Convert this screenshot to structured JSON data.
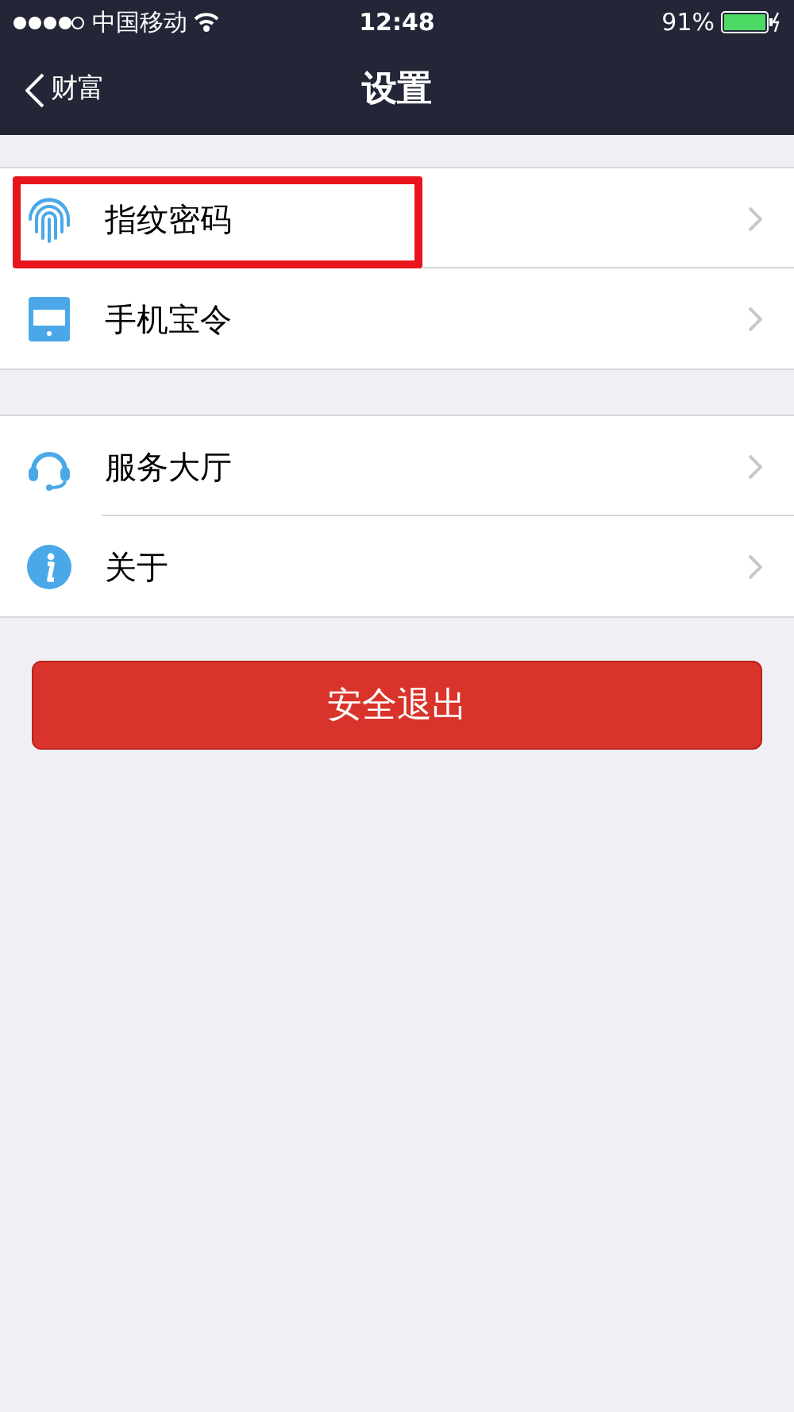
{
  "status_bar": {
    "carrier": "中国移动",
    "time": "12:48",
    "battery": "91%"
  },
  "nav": {
    "back": "财富",
    "title": "设置"
  },
  "groups": [
    {
      "items": [
        {
          "kind": "fingerprint",
          "label": "指纹密码",
          "highlighted": true
        },
        {
          "kind": "token",
          "label": "手机宝令",
          "highlighted": false
        }
      ]
    },
    {
      "items": [
        {
          "kind": "headset",
          "label": "服务大厅",
          "highlighted": false
        },
        {
          "kind": "info",
          "label": "关于",
          "highlighted": false
        }
      ]
    }
  ],
  "logout_button": "安全退出"
}
